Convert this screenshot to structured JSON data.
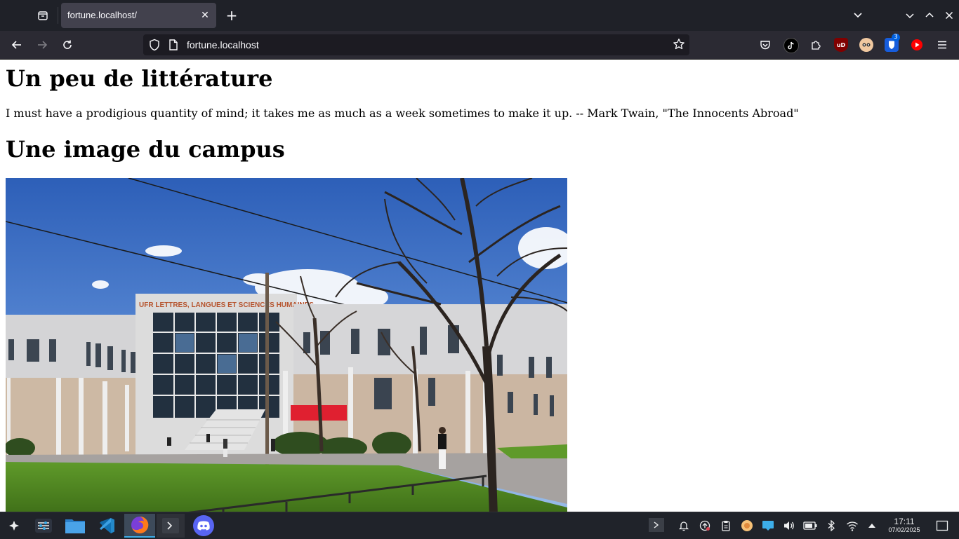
{
  "browser": {
    "tab": {
      "title": "fortune.localhost/",
      "close_glyph": "✕"
    },
    "new_tab_glyph": "+",
    "url": "fortune.localhost",
    "icons": {
      "tab_overview": "tab-overview-icon",
      "back": "back-arrow-icon",
      "forward": "forward-arrow-icon",
      "reload": "reload-icon",
      "tracking_protection": "shield-icon",
      "page_info": "page-icon",
      "bookmark": "star-icon",
      "pocket": "pocket-icon",
      "extensions": "puzzle-icon",
      "menu": "hamburger-menu-icon"
    },
    "extensions": [
      {
        "name": "tiktok-extension-icon",
        "color": "#000000"
      },
      {
        "name": "ublock-origin-icon",
        "color": "#800000",
        "label": "uD"
      },
      {
        "name": "privacy-badger-icon",
        "color": "#f08a4b"
      },
      {
        "name": "bitwarden-icon",
        "color": "#175ddc",
        "badge": "3"
      },
      {
        "name": "youtube-extension-icon",
        "color": "#ff0000"
      }
    ]
  },
  "page": {
    "heading_1": "Un peu de littérature",
    "quote": "I must have a prodigious quantity of mind; it takes me as much as a week sometimes to make it up. -- Mark Twain, \"The Innocents Abroad\"",
    "heading_2": "Une image du campus",
    "image": {
      "sign_text": "UFR LETTRES, LANGUES ET SCIENCES HUMAINES"
    }
  },
  "taskbar": {
    "apps": [
      "app-launcher-icon",
      "system-settings-icon",
      "file-manager-icon",
      "vscode-icon",
      "firefox-icon",
      "terminal-icon",
      "discord-icon"
    ],
    "clock": {
      "time": "17:11",
      "date": "07/02/2025"
    }
  }
}
